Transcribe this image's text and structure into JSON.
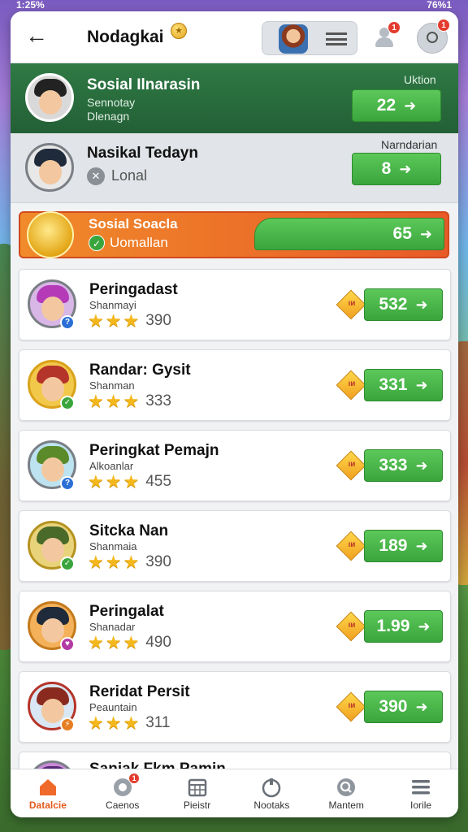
{
  "status_bar": {
    "time": "1:25%",
    "right": "76%1"
  },
  "header": {
    "title": "Nodagkai",
    "user_badge": "1",
    "search_badge": "1"
  },
  "top_rows": [
    {
      "name": "Sosial Ilnarasin",
      "sub1": "Sennotay",
      "sub2": "Dlenagn",
      "label": "Uktion",
      "value": "22"
    },
    {
      "name": "Nasikal Tedayn",
      "sub": "Lonal",
      "label": "Narndarian",
      "value": "8"
    },
    {
      "name": "Sosial Soacla",
      "sub": "Uomallan",
      "value": "65"
    }
  ],
  "cards": [
    {
      "name": "Peringadast",
      "sub": "Shanmayi",
      "score": "390",
      "value": "532",
      "badge_color": "#2b6fd6"
    },
    {
      "name": "Randar: Gysit",
      "sub": "Shanman",
      "score": "333",
      "value": "331",
      "badge_color": "#3aa53c"
    },
    {
      "name": "Peringkat Pemajn",
      "sub": "Alkoanlar",
      "score": "455",
      "value": "333",
      "badge_color": "#2b6fd6"
    },
    {
      "name": "Sitcka Nan",
      "sub": "Shanmaia",
      "score": "390",
      "value": "189",
      "badge_color": "#3aa53c"
    },
    {
      "name": "Peringalat",
      "sub": "Shanadar",
      "score": "490",
      "value": "1.99",
      "badge_color": "#b33aa5"
    },
    {
      "name": "Reridat Persit",
      "sub": "Peauntain",
      "score": "311",
      "value": "390",
      "badge_color": "#e67e22"
    },
    {
      "name": "Saniak Fkm Pamin",
      "sub": "",
      "score": "",
      "value": ""
    }
  ],
  "diamond_text": "ıᴎ",
  "bottom_nav": [
    {
      "label": "Datalcie",
      "icon": "home-icon",
      "active": true
    },
    {
      "label": "Caenos",
      "icon": "games-icon",
      "badge": "1"
    },
    {
      "label": "Pieistr",
      "icon": "calendar-icon"
    },
    {
      "label": "Nootaks",
      "icon": "pointer-icon"
    },
    {
      "label": "Mantem",
      "icon": "search-icon"
    },
    {
      "label": "Iorile",
      "icon": "menu-icon"
    }
  ]
}
